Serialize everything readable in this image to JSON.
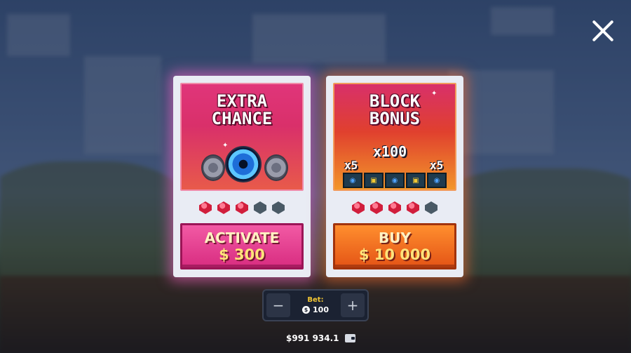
{
  "close": {
    "icon": "close-icon"
  },
  "cards": {
    "extra_chance": {
      "title_line1": "EXTRA",
      "title_line2": "CHANCE",
      "gems": {
        "filled": 3,
        "total": 5
      },
      "button_label": "ACTIVATE",
      "button_price": "$ 300",
      "accent_color": "#e0357a"
    },
    "block_bonus": {
      "title_line1": "BLOCK",
      "title_line2": "BONUS",
      "multiplier_main": "x100",
      "multiplier_left": "x5",
      "multiplier_right": "x5",
      "gems": {
        "filled": 4,
        "total": 5
      },
      "button_label": "BUY",
      "button_price": "$ 10 000",
      "accent_color": "#f2962a"
    }
  },
  "bet": {
    "label": "Bet:",
    "currency_symbol": "$",
    "value": "100",
    "minus": "−",
    "plus": "+"
  },
  "balance": {
    "amount": "$991 934.1",
    "icon": "wallet-icon"
  }
}
